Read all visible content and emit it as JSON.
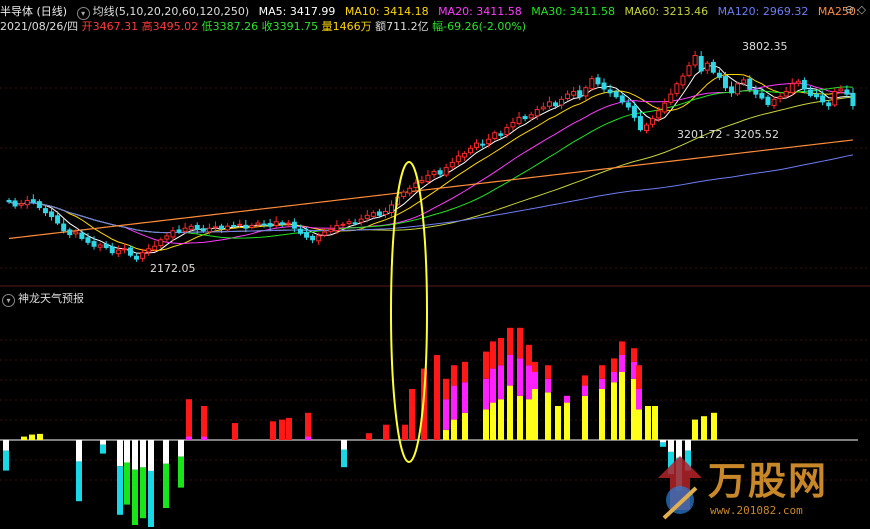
{
  "header": {
    "name": "半导体 (日线)",
    "indicator": "均线(5,10,20,20,60,120,250)",
    "ma5": "MA5: 3417.99",
    "ma10": "MA10: 3414.18",
    "ma20": "MA20: 3411.58",
    "ma30": "MA30: 3411.58",
    "ma60": "MA60: 3213.46",
    "ma120": "MA120: 2969.32",
    "ma250": "MA250:",
    "date": "2021/08/26/四",
    "open": "开3467.31",
    "high": "高3495.02",
    "low": "低3387.26",
    "close": "收3391.75",
    "volume": "量1466万",
    "amount": "额711.2亿",
    "change": "幅-69.26(-2.00%)"
  },
  "lower_panel": {
    "title": "神龙天气预报"
  },
  "annotations": {
    "low": "2172.05",
    "high": "3802.35",
    "range": "3201.72 - 3205.52"
  },
  "logo": {
    "text": "万股网",
    "url": "www.201082.com"
  },
  "colors": {
    "up": "#ff2a2a",
    "down": "#2fd6e6",
    "ma5": "#ffffff",
    "ma10": "#ffd700",
    "ma20": "#ff3cff",
    "ma30": "#21e321",
    "ma60": "#c8d43a",
    "ma120": "#6d7df5",
    "ma250": "#ff8c3a",
    "osc_yellow": "#ffff1a",
    "osc_magenta": "#ff20ff",
    "osc_red": "#ff1818",
    "osc_cyan": "#1ad7e6",
    "osc_green": "#19e619",
    "osc_white": "#ffffff",
    "highlight": "#ffff33"
  },
  "chart_data": [
    {
      "type": "candlestick",
      "title": "半导体 (日线)",
      "annotated_low": 2172.05,
      "annotated_high": 3802.35,
      "annotated_range": [
        3201.72,
        3205.52
      ],
      "ma_last": {
        "MA5": 3417.99,
        "MA10": 3414.18,
        "MA20": 3411.58,
        "MA30": 3411.58,
        "MA60": 3213.46,
        "MA120": 2969.32
      },
      "close": [
        2645,
        2612,
        2630,
        2655,
        2640,
        2600,
        2560,
        2530,
        2480,
        2420,
        2390,
        2410,
        2360,
        2330,
        2300,
        2310,
        2290,
        2250,
        2270,
        2280,
        2230,
        2200,
        2250,
        2280,
        2300,
        2350,
        2380,
        2420,
        2410,
        2440,
        2455,
        2430,
        2420,
        2440,
        2450,
        2435,
        2455,
        2460,
        2470,
        2440,
        2460,
        2480,
        2470,
        2455,
        2490,
        2470,
        2480,
        2440,
        2400,
        2370,
        2350,
        2380,
        2410,
        2430,
        2460,
        2470,
        2490,
        2480,
        2510,
        2540,
        2560,
        2540,
        2570,
        2620,
        2680,
        2720,
        2750,
        2790,
        2810,
        2850,
        2880,
        2860,
        2910,
        2950,
        3000,
        3020,
        3060,
        3100,
        3090,
        3130,
        3180,
        3160,
        3220,
        3260,
        3300,
        3290,
        3320,
        3360,
        3380,
        3420,
        3390,
        3440,
        3480,
        3500,
        3460,
        3530,
        3600,
        3560,
        3520,
        3490,
        3460,
        3420,
        3380,
        3300,
        3205,
        3240,
        3290,
        3350,
        3410,
        3480,
        3560,
        3620,
        3700,
        3780,
        3660,
        3720,
        3650,
        3610,
        3530,
        3490,
        3560,
        3590,
        3520,
        3480,
        3450,
        3400,
        3440,
        3460,
        3500,
        3560,
        3580,
        3520,
        3470,
        3460,
        3420,
        3390,
        3500,
        3520,
        3480,
        3391.75
      ]
    },
    {
      "type": "bar",
      "title": "神龙天气预报",
      "stack_order": [
        "yellow",
        "magenta",
        "red"
      ],
      "bars": [
        [
          0,
          -0.9,
          "cyan"
        ],
        [
          0.1,
          0,
          "yellow"
        ],
        [
          0.16,
          0,
          "yellow"
        ],
        [
          0.18,
          0,
          "yellow"
        ],
        [
          0,
          -1.8,
          "cyan"
        ],
        [
          0,
          -0.4,
          "cyan"
        ],
        [
          0,
          -2.2,
          "cyan"
        ],
        [
          0,
          -1.9,
          "green"
        ],
        [
          0,
          -2.5,
          "green"
        ],
        [
          0,
          -2.3,
          "green"
        ],
        [
          0,
          -2.6,
          "cyan"
        ],
        [
          0,
          -2.0,
          "green"
        ],
        [
          0,
          -1.4,
          "green"
        ],
        [
          1.2,
          0.1,
          "red"
        ],
        [
          1.0,
          0.1,
          "red"
        ],
        [
          0.5,
          0,
          "red"
        ],
        [
          0.55,
          0,
          "red"
        ],
        [
          0.6,
          0,
          "red"
        ],
        [
          0.65,
          0,
          "red"
        ],
        [
          0.8,
          0.1,
          "red"
        ],
        [
          0,
          -0.8,
          "cyan"
        ],
        [
          0.2,
          0,
          "red"
        ],
        [
          0.45,
          0,
          "red"
        ],
        [
          0.45,
          0,
          "red"
        ],
        [
          1.5,
          0,
          "red"
        ],
        [
          2.1,
          0,
          "red"
        ],
        [
          2.5,
          0,
          "red"
        ],
        [
          1.8,
          "y0.3",
          "m1.2"
        ],
        [
          2.2,
          "y0.6",
          "m1.6"
        ],
        [
          2.3,
          "y0.8",
          "m1.7"
        ],
        [
          2.6,
          "y0.9",
          "m1.8"
        ],
        [
          2.9,
          "y1.1",
          "m2.1"
        ],
        [
          3.0,
          "y1.2",
          "m2.2"
        ],
        [
          3.3,
          "y1.6",
          "m2.5"
        ],
        [
          3.3,
          "y1.3",
          "m2.4"
        ],
        [
          2.8,
          "y1.2",
          "m2.2"
        ],
        [
          2.3,
          "y1.5",
          "m2.0"
        ],
        [
          2.2,
          "y1.4",
          "m1.8"
        ],
        [
          1.0,
          "y1.0",
          "m1.0"
        ],
        [
          1.3,
          "y1.1",
          "m1.3"
        ],
        [
          1.9,
          "y1.3",
          "m1.6"
        ],
        [
          2.2,
          "y1.5",
          "m1.8"
        ],
        [
          2.4,
          "y1.7",
          "m2.0"
        ],
        [
          2.9,
          "y2.0",
          "m2.5"
        ],
        [
          2.7,
          "y1.8",
          "m2.3"
        ],
        [
          2.2,
          "y0.9",
          "m1.5"
        ],
        [
          1.0,
          "y1.0",
          "m1.0"
        ],
        [
          1.0,
          "y1.0",
          "m1.0"
        ],
        [
          0,
          -0.2,
          "cyan"
        ],
        [
          0,
          -1.0,
          "cyan"
        ],
        [
          0,
          -1.5,
          "cyan"
        ],
        [
          0,
          -0.9,
          "cyan"
        ],
        [
          0.6,
          "y0.6",
          "m0.6"
        ],
        [
          0.7,
          "y0.7",
          "m0.7"
        ],
        [
          0.8,
          "y0.8",
          "m0.8"
        ]
      ]
    }
  ]
}
